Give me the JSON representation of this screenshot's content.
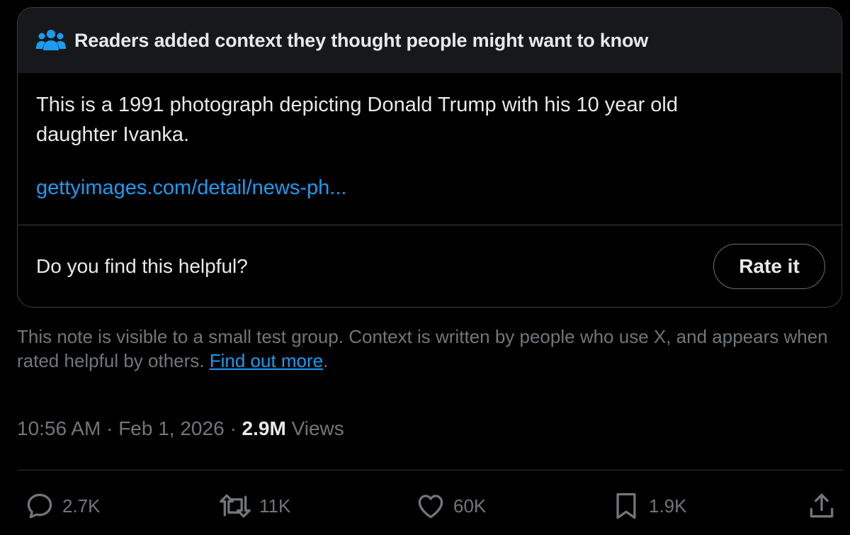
{
  "note": {
    "header_title": "Readers added context they thought people might want to know",
    "text": "This is a 1991 photograph depicting Donald Trump with his 10 year old daughter Ivanka.",
    "link_text": "gettyimages.com/detail/news-ph...",
    "helpful_question": "Do you find this helpful?",
    "rate_button": "Rate it"
  },
  "disclaimer": {
    "text": "This note is visible to a small test group. Context is written by people who use X, and appears when rated helpful by others.",
    "link_text": "Find out more",
    "trailing": "."
  },
  "meta": {
    "time": "10:56 AM",
    "separator1": "·",
    "date": "Feb 1, 2026",
    "separator2": "·",
    "views_count": "2.9M",
    "views_label": "Views"
  },
  "actions": {
    "replies": "2.7K",
    "reposts": "11K",
    "likes": "60K",
    "bookmarks": "1.9K"
  },
  "colors": {
    "background": "#000000",
    "header_bg": "#16181c",
    "text_primary": "#e7e9ea",
    "text_secondary": "#71767b",
    "link": "#1d9bf0",
    "border": "#3b3e41"
  }
}
